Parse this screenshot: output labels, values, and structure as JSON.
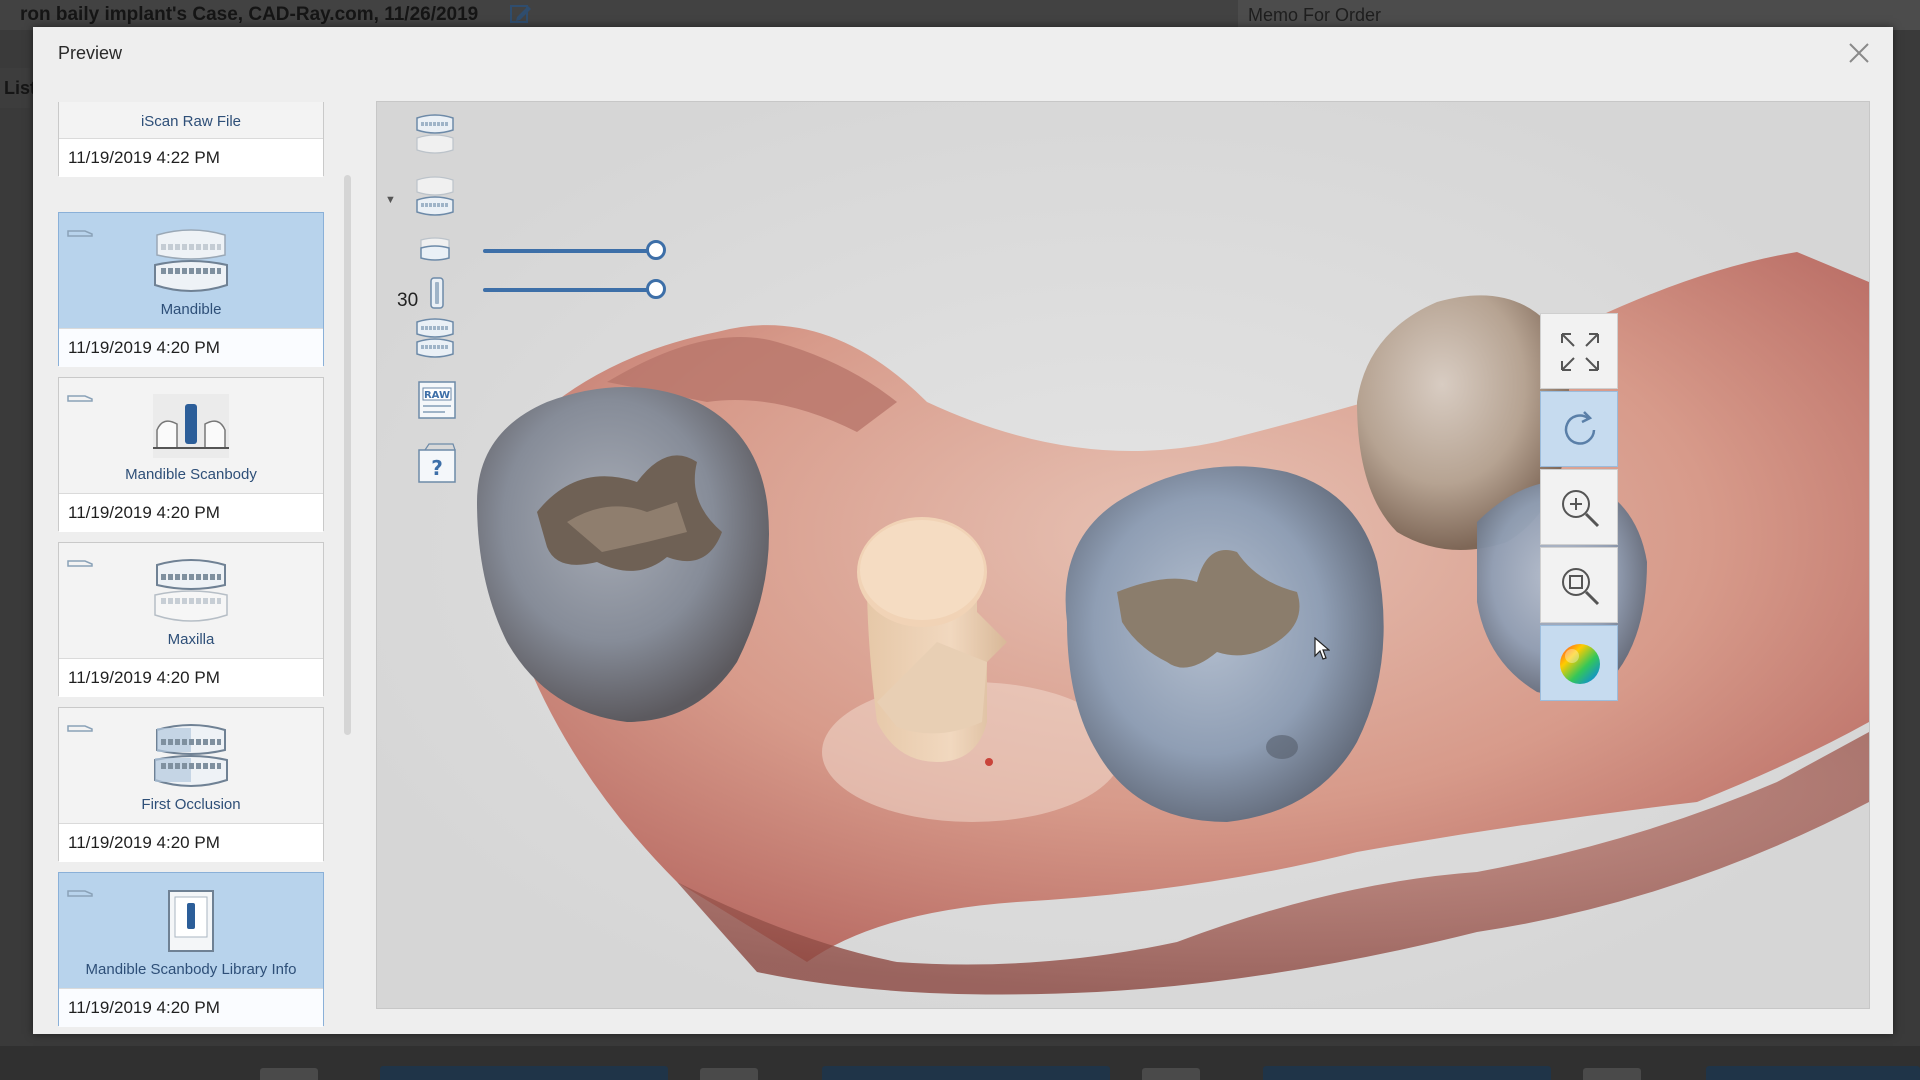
{
  "app": {
    "case_title": "ron baily implant's Case, CAD-Ray.com, 11/26/2019",
    "memo_label": "Memo For Order",
    "left_tab_label": "List"
  },
  "dialog": {
    "title": "Preview",
    "close_icon": "close-icon"
  },
  "scans": [
    {
      "label": "iScan Raw File",
      "date": "11/19/2019 4:22 PM",
      "selected": false
    },
    {
      "label": "Mandible",
      "date": "11/19/2019 4:20 PM",
      "selected": true
    },
    {
      "label": "Mandible Scanbody",
      "date": "11/19/2019 4:20 PM",
      "selected": false
    },
    {
      "label": "Maxilla",
      "date": "11/19/2019 4:20 PM",
      "selected": false
    },
    {
      "label": "First Occlusion",
      "date": "11/19/2019 4:20 PM",
      "selected": false
    },
    {
      "label": "Mandible Scanbody Library Info",
      "date": "11/19/2019 4:20 PM",
      "selected": true
    }
  ],
  "viewport_tools": {
    "slider_value": "30",
    "opacity_slider_value_pct": 100,
    "scanbody_slider_value_pct": 100,
    "icons": [
      "maxilla-toggle-icon",
      "mandible-toggle-icon",
      "scanbody-icon",
      "scanbody-depth-icon",
      "occlusion-icon",
      "raw-file-icon",
      "help-icon"
    ]
  },
  "right_tools": [
    {
      "name": "fit-to-screen",
      "icon": "expand-icon",
      "active": false
    },
    {
      "name": "rotate",
      "icon": "rotate-icon",
      "active": true
    },
    {
      "name": "zoom-in",
      "icon": "zoom-in-icon",
      "active": false
    },
    {
      "name": "zoom-window",
      "icon": "zoom-window-icon",
      "active": false
    },
    {
      "name": "color-texture",
      "icon": "color-wheel-icon",
      "active": true
    }
  ],
  "colors": {
    "accent": "#3d6fa8",
    "selected_card": "#b8d3ec",
    "link_text": "#2e4f78"
  }
}
